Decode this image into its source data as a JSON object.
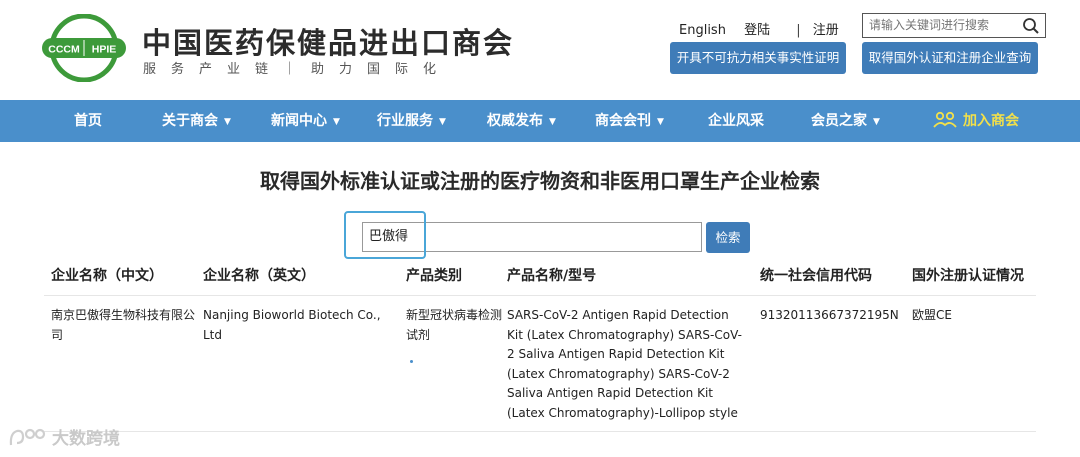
{
  "header": {
    "logo_text_left": "CCCM",
    "logo_text_right": "HPIE",
    "title": "中国医药保健品进出口商会",
    "slogan": "服务产业链｜助力国际化",
    "english_link": "English",
    "login_link": "登陆",
    "divider": "|",
    "register_link": "注册",
    "search_placeholder": "请输入关键词进行搜索",
    "btn_force_majeure": "开具不可抗力相关事实性证明",
    "btn_foreign_cert": "取得国外认证和注册企业查询"
  },
  "nav": {
    "items": [
      {
        "label": "首页",
        "caret": false
      },
      {
        "label": "关于商会",
        "caret": true
      },
      {
        "label": "新闻中心",
        "caret": true
      },
      {
        "label": "行业服务",
        "caret": true
      },
      {
        "label": "权威发布",
        "caret": true
      },
      {
        "label": "商会会刊",
        "caret": true
      },
      {
        "label": "企业风采",
        "caret": false
      },
      {
        "label": "会员之家",
        "caret": true
      },
      {
        "label": "加入商会",
        "caret": false
      }
    ],
    "caret_glyph": "▼"
  },
  "main": {
    "title": "取得国外标准认证或注册的医疗物资和非医用口罩生产企业检索",
    "search_value": "巴傲得",
    "search_button": "检索",
    "columns": [
      "企业名称（中文）",
      "企业名称（英文）",
      "产品类别",
      "产品名称/型号",
      "统一社会信用代码",
      "国外注册认证情况"
    ],
    "rows": [
      {
        "name_cn": "南京巴傲得生物科技有限公司",
        "name_en": "Nanjing Bioworld Biotech Co., Ltd",
        "category": "新型冠状病毒检测试剂",
        "product": "SARS-CoV-2 Antigen Rapid Detection Kit (Latex Chromatography) SARS-CoV-2 Saliva Antigen Rapid Detection Kit (Latex Chromatography) SARS-CoV-2 Saliva Antigen Rapid Detection Kit (Latex Chromatography)-Lollipop style",
        "credit_code": "91320113667372195N",
        "certification": "欧盟CE"
      }
    ]
  },
  "watermark": {
    "text": "大数跨境"
  },
  "colors": {
    "nav_bg": "#4a8fcb",
    "button_bg": "#3f7cb8",
    "logo_green": "#3d9a3a",
    "join_yellow": "#f2e04a",
    "highlight_border": "#4aa6d8"
  }
}
